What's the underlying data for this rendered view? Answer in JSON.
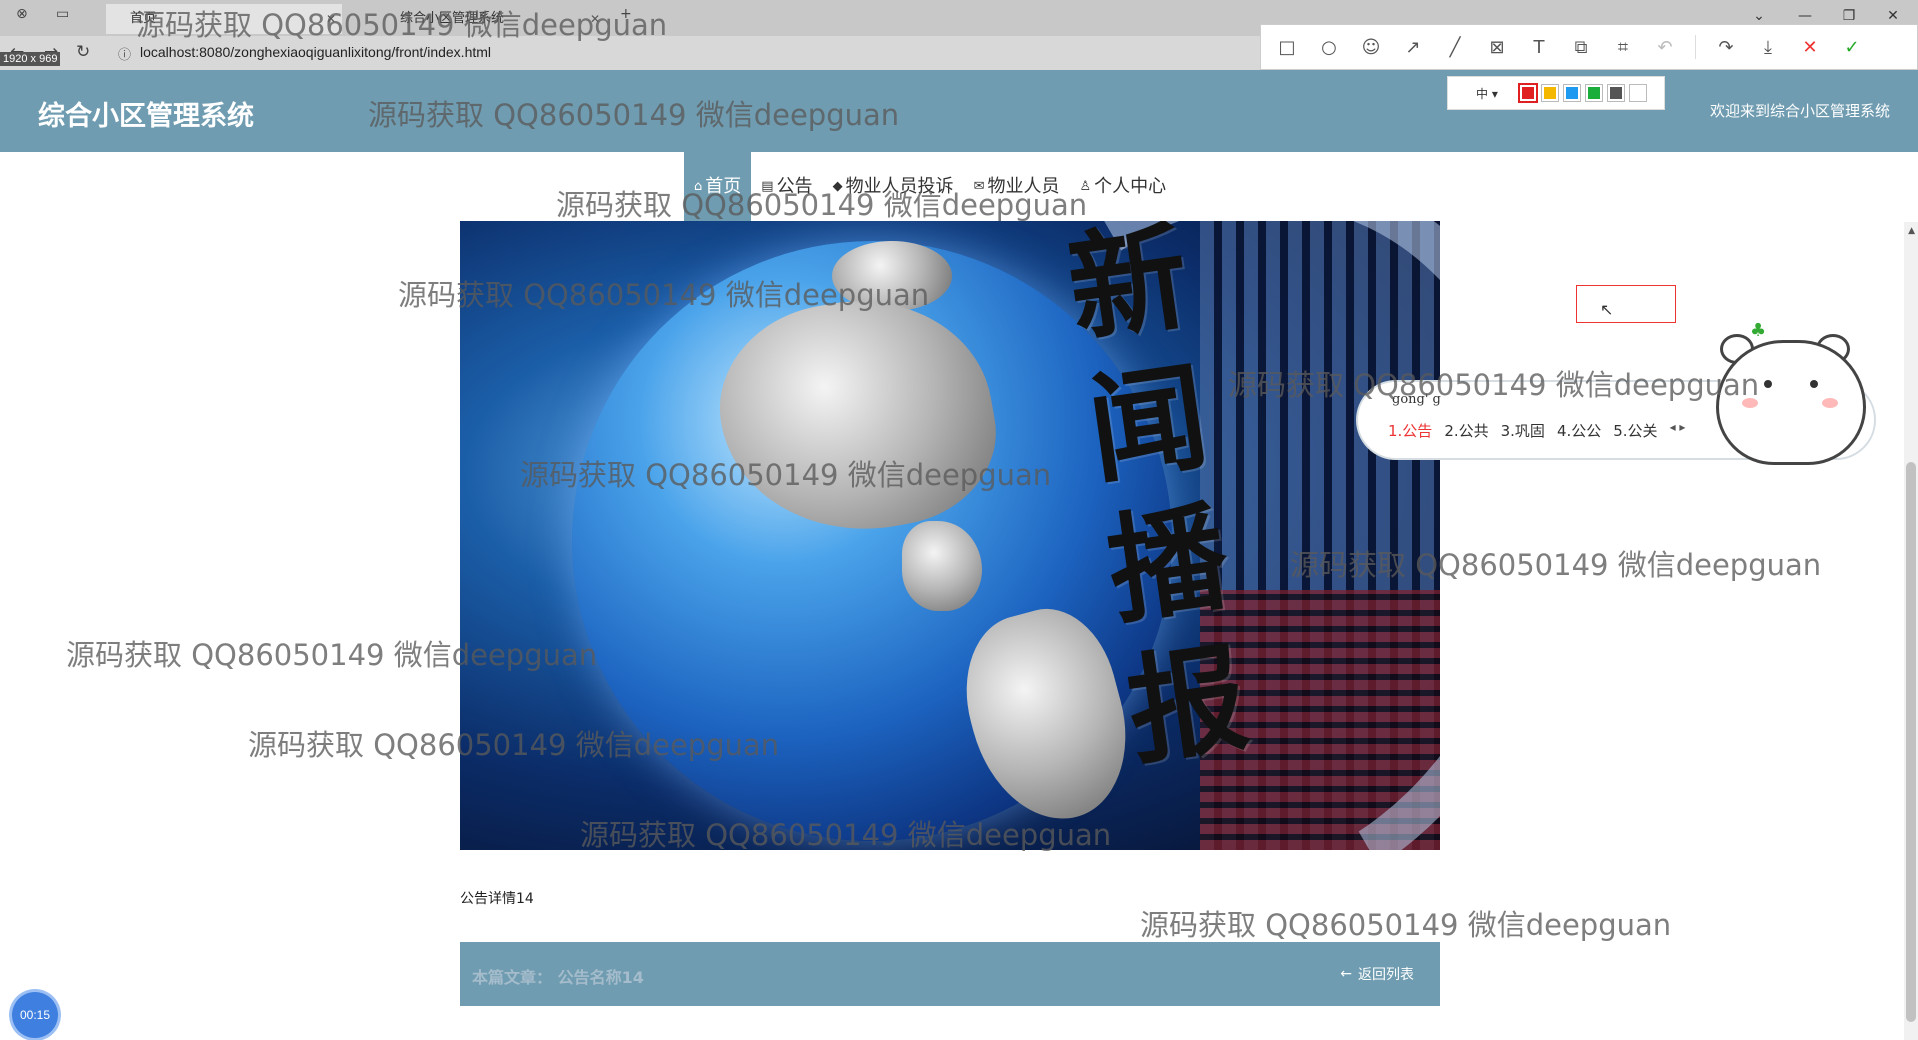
{
  "browser": {
    "tabs": [
      {
        "label": "首页"
      },
      {
        "label": "综合小区管理系统"
      }
    ],
    "new_tab_icon": "+",
    "url": "localhost:8080/zonghexiaoqiguanlixitong/front/index.html",
    "dimension_label": "1920 x 969"
  },
  "header": {
    "title": "综合小区管理系统",
    "welcome": "欢迎来到综合小区管理系统"
  },
  "nav": {
    "items": [
      {
        "label": "首页",
        "icon": "home-icon",
        "active": true
      },
      {
        "label": "公告",
        "icon": "notice-icon"
      },
      {
        "label": "物业人员投诉",
        "icon": "graduation-cap-icon"
      },
      {
        "label": "物业人员",
        "icon": "mail-icon"
      },
      {
        "label": "个人中心",
        "icon": "user-icon"
      }
    ]
  },
  "banner": {
    "text": [
      "新",
      "闻",
      "播",
      "报"
    ]
  },
  "detail": {
    "content": "公告详情14",
    "article_label": "本篇文章：",
    "article_title": "公告名称14",
    "back_label": "返回列表"
  },
  "snip_toolbar": {
    "size_label": "中",
    "colors": [
      "#e02020",
      "#f5b800",
      "#1e9bf0",
      "#1cae3a",
      "#555555",
      "#ffffff"
    ],
    "tools": [
      "rectangle-icon",
      "ellipse-icon",
      "emoji-icon",
      "arrow-icon",
      "line-icon",
      "mosaic-icon",
      "text-icon",
      "copy-icon",
      "ocr-icon",
      "undo-icon",
      "share-icon",
      "download-icon",
      "cancel-icon",
      "confirm-icon"
    ]
  },
  "ime": {
    "pinyin": "gong' g",
    "candidates": [
      "1.公告",
      "2.公共",
      "3.巩固",
      "4.公公",
      "5.公关"
    ]
  },
  "timer": "00:15",
  "watermark": "源码获取 QQ86050149 微信deepguan"
}
